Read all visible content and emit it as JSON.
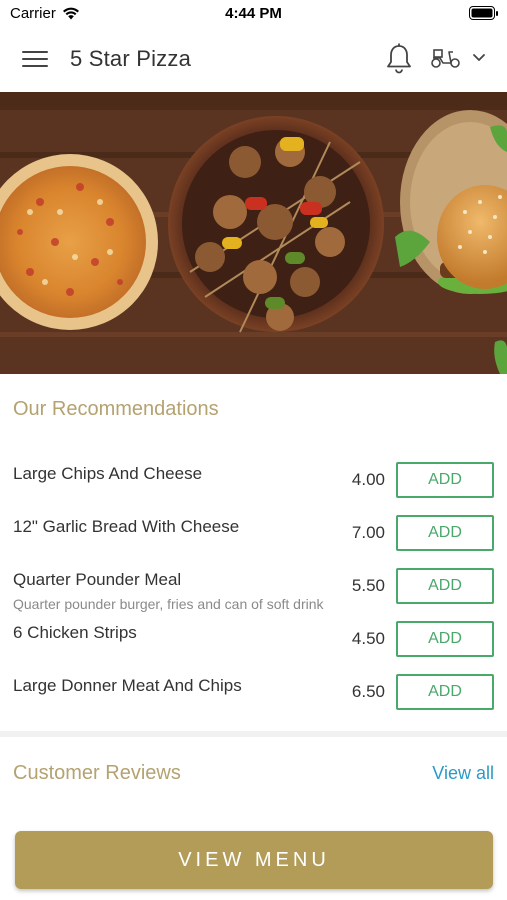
{
  "status_bar": {
    "carrier": "Carrier",
    "time": "4:44 PM"
  },
  "nav": {
    "title": "5 Star Pizza",
    "icons": [
      "hamburger-menu-icon",
      "bell-icon",
      "scooter-icon",
      "chevron-down-icon"
    ]
  },
  "hero": {
    "image": "pizza, kebab skewers and burger on wooden table"
  },
  "recommendations": {
    "title": "Our Recommendations",
    "items": [
      {
        "name": "Large Chips And Cheese",
        "description": "",
        "price": "4.00",
        "add_label": "ADD"
      },
      {
        "name": "12\" Garlic Bread With Cheese",
        "description": "",
        "price": "7.00",
        "add_label": "ADD"
      },
      {
        "name": "Quarter Pounder Meal",
        "description": "Quarter pounder burger, fries and can of soft drink",
        "price": "5.50",
        "add_label": "ADD"
      },
      {
        "name": "6 Chicken Strips",
        "description": "",
        "price": "4.50",
        "add_label": "ADD"
      },
      {
        "name": "Large Donner Meat And Chips",
        "description": "",
        "price": "6.50",
        "add_label": "ADD"
      }
    ]
  },
  "reviews": {
    "title": "Customer Reviews",
    "view_all_label": "View all"
  },
  "footer": {
    "view_menu_label": "VIEW MENU"
  },
  "colors": {
    "accent_gold": "#b29c58",
    "section_title": "#b4a271",
    "add_green": "#4aa86b",
    "link_blue": "#2b9ac8"
  }
}
